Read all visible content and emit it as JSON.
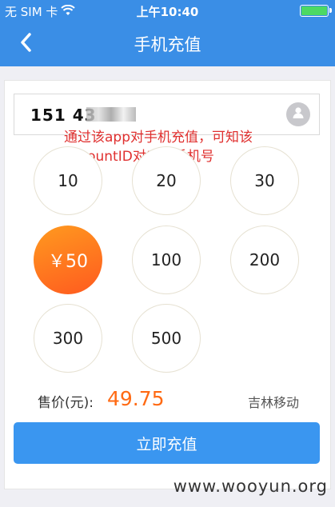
{
  "status_bar": {
    "carrier": "无 SIM 卡",
    "wifi_icon": "wifi-icon",
    "time": "上午10:40",
    "battery_color": "#4cd964"
  },
  "nav": {
    "back_icon": "chevron-left-icon",
    "title": "手机充值"
  },
  "phone": {
    "number_visible": "151 43",
    "contact_icon": "contact-icon"
  },
  "annotation": {
    "line1": "通过该app对手机充值，可知该",
    "line2": "accountID对应的手机号"
  },
  "amounts": [
    {
      "label": "10",
      "selected": false
    },
    {
      "label": "20",
      "selected": false
    },
    {
      "label": "30",
      "selected": false
    },
    {
      "label": "￥50",
      "selected": true
    },
    {
      "label": "100",
      "selected": false
    },
    {
      "label": "200",
      "selected": false
    },
    {
      "label": "300",
      "selected": false
    },
    {
      "label": "500",
      "selected": false
    }
  ],
  "price": {
    "label": "售价(元):",
    "value": "49.75",
    "carrier_name": "吉林移动"
  },
  "submit_label": "立即充值",
  "watermark": "www.wooyun.org",
  "colors": {
    "header": "#3a8ee6",
    "accent_orange": "#ff6a13",
    "button": "#3a96f0",
    "annotation": "#e0302f"
  }
}
